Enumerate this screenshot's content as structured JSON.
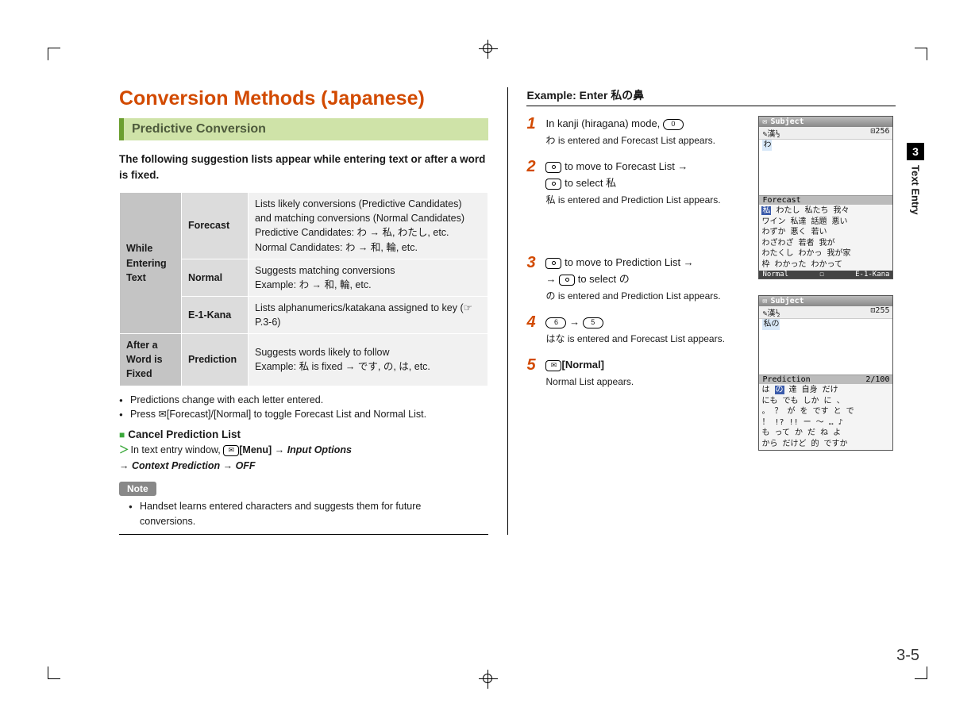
{
  "page": {
    "number": "3-5",
    "chapter_num": "3",
    "chapter_label": "Text Entry"
  },
  "left": {
    "title": "Conversion Methods (Japanese)",
    "subhead": "Predictive Conversion",
    "intro": "The following suggestion lists appear while entering text or after a word is fixed.",
    "table": {
      "row_while": "While Entering Text",
      "row_after": "After a Word is Fixed",
      "forecast": {
        "name": "Forecast",
        "desc": "Lists likely conversions (Predictive Candidates) and matching conversions (Normal Candidates)\nPredictive Candidates: わ → 私, わたし, etc.\nNormal Candidates: わ → 和, 輪, etc."
      },
      "normal": {
        "name": "Normal",
        "desc": "Suggests matching conversions\nExample: わ → 和, 輪, etc."
      },
      "e1kana": {
        "name": "E-1-Kana",
        "desc": "Lists alphanumerics/katakana assigned to key (☞P.3-6)"
      },
      "prediction": {
        "name": "Prediction",
        "desc": "Suggests words likely to follow\nExample: 私 is fixed → です, の, は, etc."
      }
    },
    "bullets": [
      "Predictions change with each letter entered.",
      "Press ✉[Forecast]/[Normal] to toggle Forecast List and Normal List."
    ],
    "cancel_head": "Cancel Prediction List",
    "cancel_line1_a": "In text entry window, ",
    "cancel_menu": "[Menu]",
    "cancel_io": "Input Options",
    "cancel_cp": "Context Prediction",
    "cancel_off": "OFF",
    "note_label": "Note",
    "note_item": "Handset learns entered characters and suggests them for future conversions."
  },
  "right": {
    "example_head": "Example: Enter 私の鼻",
    "steps": {
      "s1": {
        "main_a": "In kanji (hiragana) mode, ",
        "key": "0",
        "sub": "わ is entered and Forecast List appears."
      },
      "s2": {
        "main_a": " to move to Forecast List → ",
        "main_b": " to select 私",
        "sub": "私 is entered and Prediction List appears."
      },
      "s3": {
        "main_a": " to move to Prediction List → ",
        "main_b": " to select の",
        "sub": "の is entered and Prediction List appears."
      },
      "s4": {
        "k1": "6",
        "k2": "5",
        "sub": "はな is entered and Forecast List appears."
      },
      "s5": {
        "label": "[Normal]",
        "sub": "Normal List appears."
      }
    },
    "screens": {
      "a": {
        "title": "Subject",
        "mode": "漢½",
        "count": "256",
        "entry": "わ",
        "section": "Forecast",
        "cands": "私 わたし 私たち 我々\nワイン 私達 話題 悪い\nわずか 悪く 若い\nわざわざ 若者 我が\nわたくし わかっ 我が家\n枠 わかった わかって",
        "bot_l": "Normal",
        "bot_m": "☐",
        "bot_r": "E-1-Kana"
      },
      "b": {
        "title": "Subject",
        "mode": "漢½",
        "count": "255",
        "entry": "私の",
        "section": "Prediction",
        "section_r": "2/100",
        "cands": "は の 達 自身 だけ\nにも でも しか に 、\n。 ？ が を です と で\n！ !? !! ー ～ … ♪\nも って か だ ね よ\nから だけど 的 ですか"
      }
    }
  }
}
